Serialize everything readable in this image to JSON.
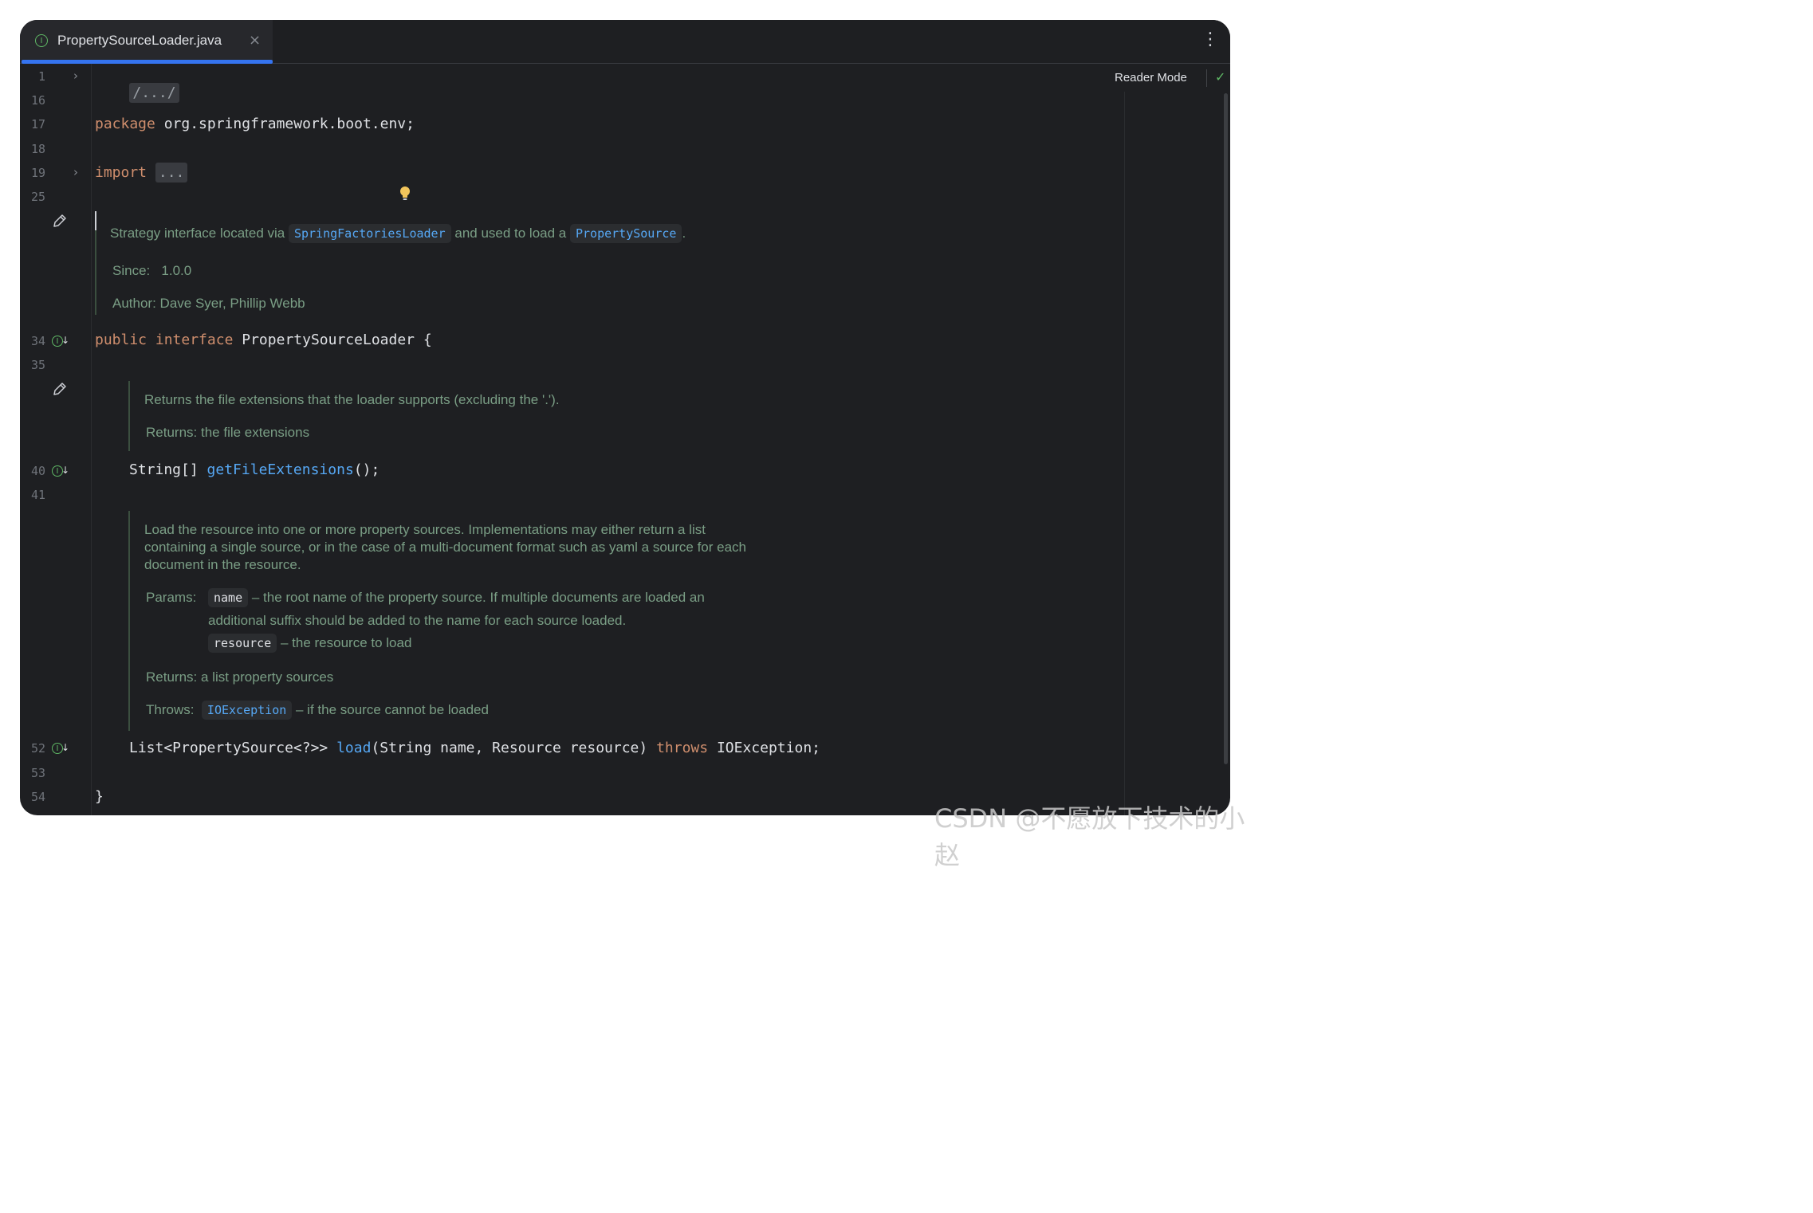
{
  "tab": {
    "icon": "interface-icon",
    "icon_glyph": "I",
    "label": "PropertySourceLoader.java",
    "close": "×"
  },
  "toolbar": {
    "more": "⋮",
    "reader_mode": "Reader Mode",
    "check": "✓"
  },
  "lines": [
    "1",
    "16",
    "17",
    "18",
    "19",
    "25",
    "34",
    "35",
    "40",
    "41",
    "52",
    "53",
    "54"
  ],
  "code": {
    "fold_header": "/.../",
    "package_kw": "package",
    "package_name": " org.springframework.boot.env;",
    "import_kw": "import",
    "import_fold": "...",
    "public_kw": "public",
    "interface_kw": "interface",
    "class_decl": " PropertySourceLoader {",
    "m1_type": "String[] ",
    "m1_name": "getFileExtensions",
    "m1_tail": "();",
    "m2_type": "List<PropertySource<?>> ",
    "m2_name": "load",
    "m2_params": "(String name, Resource resource) ",
    "m2_throws": "throws",
    "m2_tail": " IOException;",
    "closing": "}"
  },
  "doc1": {
    "pre": "Strategy interface located via",
    "link1": "SpringFactoriesLoader",
    "mid": "and used to load a",
    "link2": "PropertySource",
    "post": ".",
    "since_label": "Since:",
    "since_value": "1.0.0",
    "author_label": "Author:",
    "author_value": "Dave Syer, Phillip Webb"
  },
  "doc2": {
    "text": "Returns the file extensions that the loader supports (excluding the '.').",
    "returns_label": "Returns:",
    "returns_value": "the file extensions"
  },
  "doc3": {
    "line1": "Load the resource into one or more property sources. Implementations may either return a list",
    "line2": "containing a single source, or in the case of a multi-document format such as yaml a source for each",
    "line3": "document in the resource.",
    "params_label": "Params:",
    "param1_name": "name",
    "param1_desc": "– the root name of the property source. If multiple documents are loaded an",
    "param1_desc2": "additional suffix should be added to the name for each source loaded.",
    "param2_name": "resource",
    "param2_desc": "– the resource to load",
    "returns_label": "Returns:",
    "returns_value": "a list property sources",
    "throws_label": "Throws:",
    "throws_link": "IOException",
    "throws_desc": "– if the source cannot be loaded"
  },
  "colors": {
    "background": "#1e1f22",
    "keyword": "#cf8e6d",
    "method": "#56a8f5",
    "doc": "#7a9e85",
    "accent": "#3574f0"
  },
  "watermark": "CSDN @不愿放下技术的小赵"
}
